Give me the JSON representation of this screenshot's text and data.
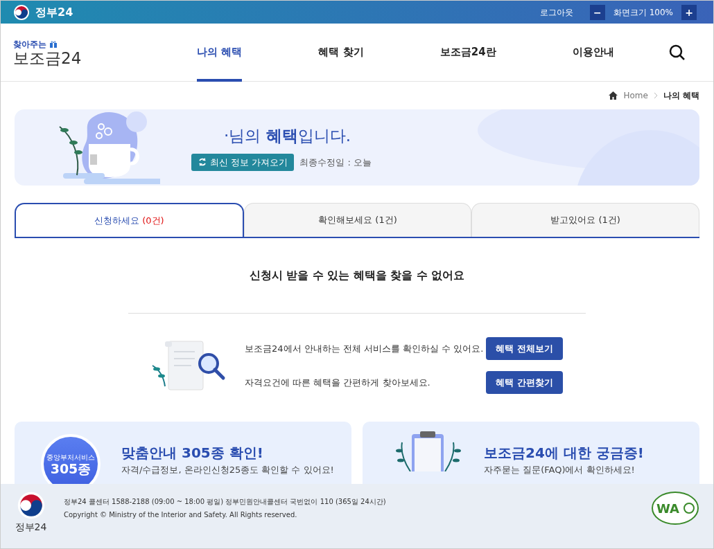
{
  "topbar": {
    "brand": "정부24",
    "logout": "로그아웃",
    "zoom_out": "−",
    "zoom_label": "화면크기 100%",
    "zoom_in": "+"
  },
  "header": {
    "logo_tagline": "찾아주는",
    "logo_name": "보조금24",
    "nav": [
      {
        "label": "나의 혜택",
        "selected": true
      },
      {
        "label": "혜택 찾기",
        "selected": false
      },
      {
        "label": "보조금24란",
        "selected": false
      },
      {
        "label": "이용안내",
        "selected": false
      }
    ]
  },
  "breadcrumb": [
    "Home",
    "나의 혜택"
  ],
  "banner": {
    "title": "·님의 **혜택**입니다.",
    "refresh_button": "최신 정보 가져오기",
    "updated": "최종수정일 : 오늘"
  },
  "tabs": [
    {
      "label": "신청하세요",
      "count": "(0건)",
      "selected": true
    },
    {
      "label": "확인해보세요",
      "count": "(1건)",
      "selected": false
    },
    {
      "label": "받고있어요",
      "count": "(1건)",
      "selected": false
    }
  ],
  "empty_message": "신청시 받을 수 있는 혜택을 찾을 수 없어요",
  "suggestions": [
    {
      "text": "보조금24에서 안내하는 전체 서비스를 확인하실 수 있어요.",
      "button": "혜택 전체보기"
    },
    {
      "text": "자격요건에 따른 혜택을 간편하게 찾아보세요.",
      "button": "혜택 간편찾기"
    }
  ],
  "promos": [
    {
      "kind": "badge",
      "badge_caption": "중앙부처서비스",
      "badge_value": "305종",
      "title": "맞춤안내 305종 확인!",
      "desc": "자격/수급정보, 온라인신청25종도 확인할 수 있어요!"
    },
    {
      "kind": "faq",
      "title": "보조금24에 대한 궁금증!",
      "desc": "자주묻는 질문(FAQ)에서 확인하세요!"
    }
  ],
  "footer": {
    "logo_name": "정부24",
    "contact": "정부24 콜센터 1588-2188 (09:00 ~ 18:00 평일) 정부민원안내콜센터 국번없이 110 (365일 24시간)",
    "copyright": "Copyright © Ministry of the Interior and Safety. All Rights reserved.",
    "mark_text": "WA"
  }
}
